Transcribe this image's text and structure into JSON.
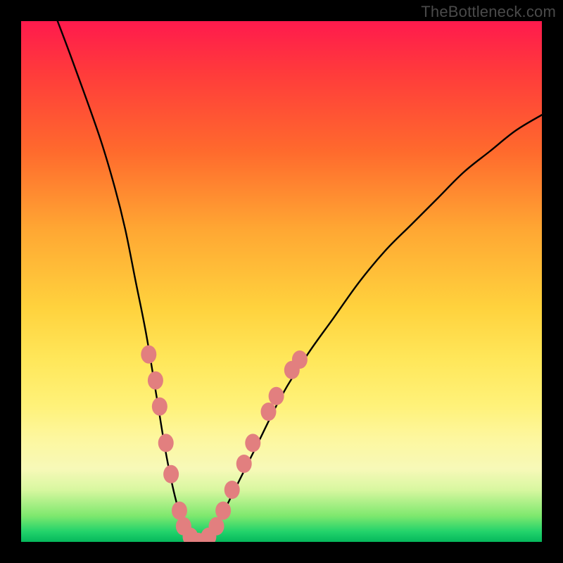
{
  "watermark": "TheBottleneck.com",
  "chart_data": {
    "type": "line",
    "title": "",
    "xlabel": "",
    "ylabel": "",
    "xlim": [
      0,
      100
    ],
    "ylim": [
      0,
      100
    ],
    "series": [
      {
        "name": "bottleneck-curve",
        "x": [
          7,
          10,
          15,
          18,
          20,
          22,
          24,
          26,
          28,
          30,
          32,
          34,
          35,
          37,
          40,
          45,
          50,
          55,
          60,
          65,
          70,
          75,
          80,
          85,
          90,
          95,
          100
        ],
        "y": [
          100,
          92,
          78,
          68,
          60,
          50,
          40,
          28,
          16,
          7,
          2,
          0,
          0,
          2,
          8,
          18,
          28,
          36,
          43,
          50,
          56,
          61,
          66,
          71,
          75,
          79,
          82
        ]
      }
    ],
    "markers": {
      "name": "highlight-dots",
      "color": "#e27f7f",
      "points": [
        {
          "x": 24.5,
          "y": 36
        },
        {
          "x": 25.8,
          "y": 31
        },
        {
          "x": 26.6,
          "y": 26
        },
        {
          "x": 27.8,
          "y": 19
        },
        {
          "x": 28.8,
          "y": 13
        },
        {
          "x": 30.4,
          "y": 6
        },
        {
          "x": 31.2,
          "y": 3
        },
        {
          "x": 32.5,
          "y": 1
        },
        {
          "x": 34.0,
          "y": 0
        },
        {
          "x": 35.0,
          "y": 0
        },
        {
          "x": 36.0,
          "y": 1
        },
        {
          "x": 37.5,
          "y": 3
        },
        {
          "x": 38.8,
          "y": 6
        },
        {
          "x": 40.5,
          "y": 10
        },
        {
          "x": 42.8,
          "y": 15
        },
        {
          "x": 44.5,
          "y": 19
        },
        {
          "x": 47.5,
          "y": 25
        },
        {
          "x": 49.0,
          "y": 28
        },
        {
          "x": 52.0,
          "y": 33
        },
        {
          "x": 53.5,
          "y": 35
        }
      ]
    },
    "gradient_meaning": "red (top) = high bottleneck, green (bottom) = low bottleneck"
  }
}
